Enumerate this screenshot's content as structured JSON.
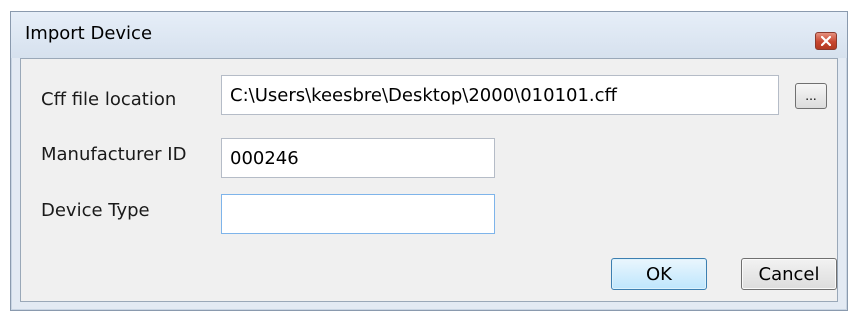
{
  "window": {
    "title": "Import Device",
    "close_icon": "close-x-icon"
  },
  "form": {
    "cff_label": "Cff file location",
    "cff_value": "C:\\Users\\keesbre\\Desktop\\2000\\010101.cff",
    "browse_label": "...",
    "manufacturer_label": "Manufacturer ID",
    "manufacturer_value": "000246",
    "device_type_label": "Device Type",
    "device_type_value": ""
  },
  "buttons": {
    "ok_label": "OK",
    "cancel_label": "Cancel"
  },
  "colors": {
    "dialog_frame": "#e3eaf3",
    "client_area": "#f0f0f0",
    "close_button": "#c8462f",
    "ok_button_border": "#3c7fb1"
  }
}
